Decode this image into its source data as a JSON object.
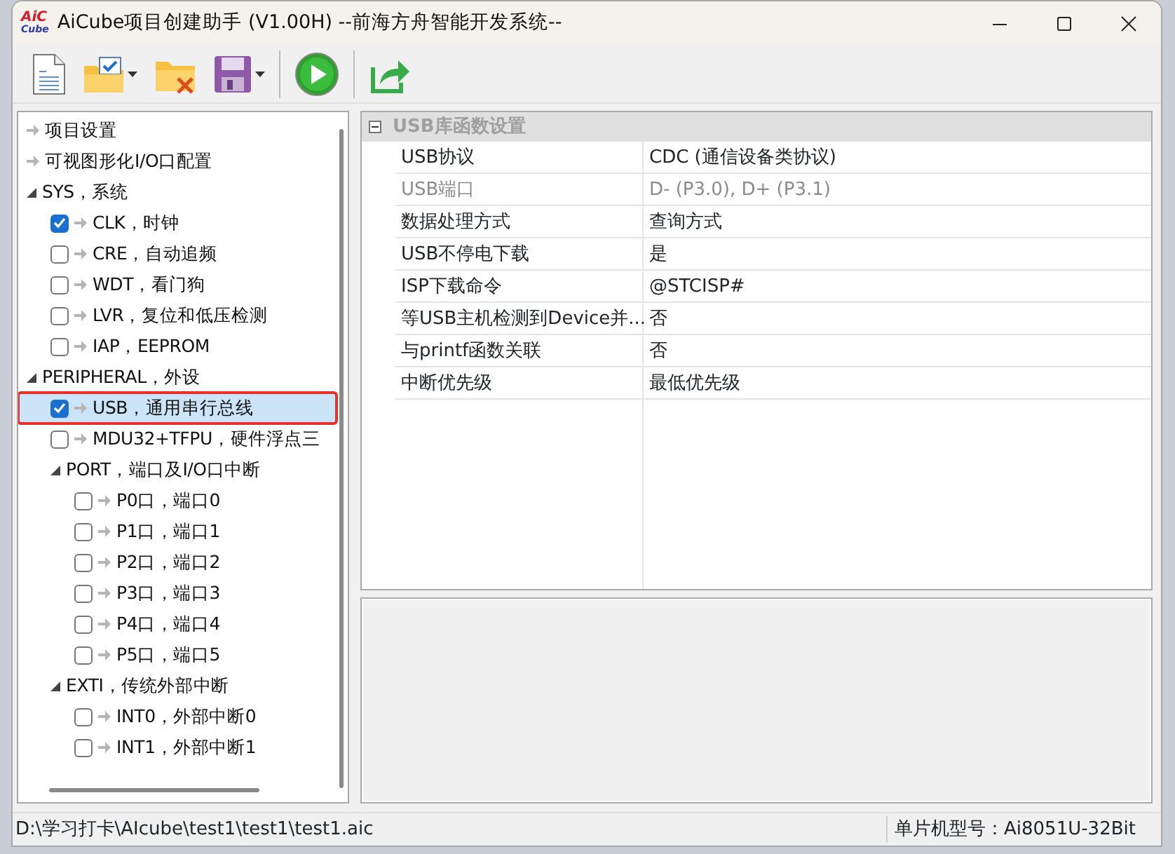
{
  "window": {
    "logo": {
      "line_1": "AiC",
      "line_2": "Cube"
    },
    "title": "AiCube项目创建助手 (V1.00H) --前海方舟智能开发系统--"
  },
  "toolbar": [
    {
      "kind": "new",
      "dropdown": false
    },
    {
      "kind": "open",
      "dropdown": true
    },
    {
      "kind": "close",
      "dropdown": false
    },
    {
      "kind": "save",
      "dropdown": true
    },
    {
      "kind": "run",
      "dropdown": false
    },
    {
      "kind": "export",
      "dropdown": false
    }
  ],
  "tree": [
    {
      "label": "项目设置",
      "kind": "page",
      "selected": false
    },
    {
      "label": "可视图形化I/O口配置",
      "kind": "page",
      "selected": false
    },
    {
      "label": "SYS，系统",
      "kind": "group",
      "expanded": true,
      "selected": false,
      "children": [
        {
          "label": "CLK，时钟",
          "kind": "option",
          "checked": true,
          "selected": false
        },
        {
          "label": "CRE，自动追频",
          "kind": "option",
          "checked": false,
          "selected": false
        },
        {
          "label": "WDT，看门狗",
          "kind": "option",
          "checked": false,
          "selected": false
        },
        {
          "label": "LVR，复位和低压检测",
          "kind": "option",
          "checked": false,
          "selected": false
        },
        {
          "label": "IAP，EEPROM",
          "kind": "option",
          "checked": false,
          "selected": false
        }
      ]
    },
    {
      "label": "PERIPHERAL，外设",
      "kind": "group",
      "expanded": true,
      "selected": false,
      "children": [
        {
          "label": "USB，通用串行总线",
          "kind": "option",
          "checked": true,
          "selected": true
        },
        {
          "label": "MDU32+TFPU，硬件浮点三",
          "kind": "option",
          "checked": false,
          "selected": false
        },
        {
          "label": "PORT，端口及I/O口中断",
          "kind": "group",
          "expanded": true,
          "selected": false,
          "children": [
            {
              "label": "P0口，端口0",
              "kind": "option",
              "checked": false,
              "selected": false
            },
            {
              "label": "P1口，端口1",
              "kind": "option",
              "checked": false,
              "selected": false
            },
            {
              "label": "P2口，端口2",
              "kind": "option",
              "checked": false,
              "selected": false
            },
            {
              "label": "P3口，端口3",
              "kind": "option",
              "checked": false,
              "selected": false
            },
            {
              "label": "P4口，端口4",
              "kind": "option",
              "checked": false,
              "selected": false
            },
            {
              "label": "P5口，端口5",
              "kind": "option",
              "checked": false,
              "selected": false
            }
          ]
        },
        {
          "label": "EXTI，传统外部中断",
          "kind": "group",
          "expanded": true,
          "selected": false,
          "children": [
            {
              "label": "INT0，外部中断0",
              "kind": "option",
              "checked": false,
              "selected": false
            },
            {
              "label": "INT1，外部中断1",
              "kind": "option",
              "checked": false,
              "selected": false
            }
          ]
        }
      ]
    }
  ],
  "properties": {
    "category": "USB库函数设置",
    "expanded": true,
    "rows": [
      {
        "name": "USB协议",
        "value": "CDC (通信设备类协议)",
        "disabled": false
      },
      {
        "name": "USB端口",
        "value": "D- (P3.0), D+ (P3.1)",
        "disabled": true
      },
      {
        "name": "数据处理方式",
        "value": "查询方式",
        "disabled": false
      },
      {
        "name": "USB不停电下载",
        "value": "是",
        "disabled": false
      },
      {
        "name": "ISP下载命令",
        "value": "@STCISP#",
        "disabled": false
      },
      {
        "name": "等USB主机检测到Device并...",
        "value": "否",
        "disabled": false
      },
      {
        "name": "与printf函数关联",
        "value": "否",
        "disabled": false
      },
      {
        "name": "中断优先级",
        "value": "最低优先级",
        "disabled": false
      }
    ]
  },
  "status_bar": {
    "path": "D:\\学习打卡\\AIcube\\test1\\test1\\test1.aic",
    "chip_model": "单片机型号：Ai8051U-32Bit"
  }
}
